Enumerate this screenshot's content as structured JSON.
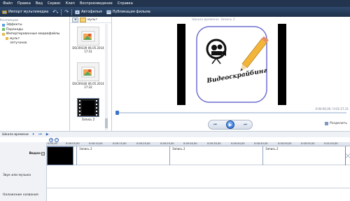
{
  "menu": [
    "Файл",
    "Правка",
    "Вид",
    "Сервис",
    "Клип",
    "Воспроизведение",
    "Справка"
  ],
  "toolbar": {
    "import_label": "Импорт мультимедиа",
    "automovie_label": "Автофильм",
    "publish_label": "Публикация фильма"
  },
  "tree": {
    "header": "Коллекции",
    "items": [
      "Эффекты",
      "Переходы",
      "Импортированные медиафайлы",
      "мульт",
      "летучонок"
    ]
  },
  "thumbs": {
    "breadcrumb": "мульт",
    "items": [
      {
        "caption_line1": "DSC09339 06.05.2014",
        "caption_line2": "17:31"
      },
      {
        "caption_line1": "DSC09340 06.05.2014",
        "caption_line2": "17:32"
      },
      {
        "caption_line1": "Запись 2",
        "caption_line2": ""
      }
    ]
  },
  "preview": {
    "title": "Шкала времени: Запись 2",
    "logo_text": "Видеоскрайбинг",
    "timecode": "0:00:00,00 / 0:01:27,31",
    "split_label": "Разделить"
  },
  "timeline": {
    "label": "Шкала времени",
    "ruler": [
      "0:00,00",
      "0:00:05,00",
      "0:00:10,00",
      "0:00:15,00",
      "0:00:20,00",
      "0:00:25,00",
      "0:00:30,00",
      "0:00:35,00",
      "0:00:40,00",
      "0:00:45,00",
      "0:00:50,00",
      "0:00:55,00",
      "0:01:00,00",
      "0:01:05,00"
    ],
    "tracks": {
      "video": "Видео",
      "audio": "Звук или музыка",
      "overlay": "Наложение названия"
    },
    "clips": [
      "Запись 2",
      "Запись 2",
      "Запись 2"
    ]
  },
  "colors": {
    "menubar": "#23354e",
    "accent": "#1f5fc4"
  }
}
